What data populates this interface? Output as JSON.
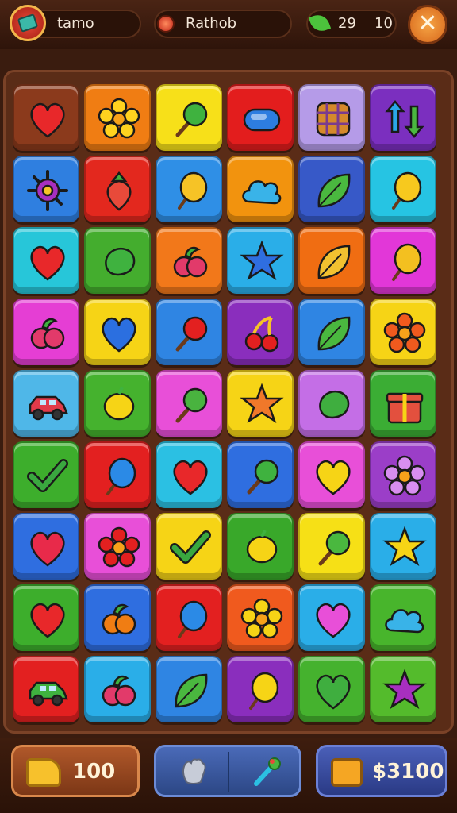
{
  "hud": {
    "player_name": "tamo",
    "resource_label": "Rathob",
    "leaf_count": "29",
    "moves": "10"
  },
  "bottom": {
    "coins": "100",
    "cash": "$3100"
  },
  "icons": {
    "profile": "profile-card-icon",
    "resource": "gem-icon",
    "leaf": "leaf-icon",
    "close": "close-icon",
    "coins": "cheese-coin-icon",
    "tool1": "glove-icon",
    "tool2": "wand-icon",
    "cash": "treasure-box-icon"
  },
  "close_glyph": "✕",
  "board": {
    "rows": 9,
    "cols": 6,
    "tiles": [
      [
        {
          "bg": "#8b3a1c",
          "icon": "heart",
          "color": "#e8282a"
        },
        {
          "bg": "#f07d13",
          "icon": "flower",
          "color": "#ffd21f"
        },
        {
          "bg": "#f7e019",
          "icon": "lollipop",
          "color": "#3fb23f"
        },
        {
          "bg": "#e31d1d",
          "icon": "capsule",
          "color": "#2d7de0"
        },
        {
          "bg": "#b59be8",
          "icon": "waffle",
          "color": "#7a3b8e"
        },
        {
          "bg": "#7b2fbf",
          "icon": "arrows",
          "color": "#2aa8e8"
        }
      ],
      [
        {
          "bg": "#2f7fe0",
          "icon": "virus",
          "color": "#a72fbf"
        },
        {
          "bg": "#e3281e",
          "icon": "strawberry",
          "color": "#e84a3a"
        },
        {
          "bg": "#2f8fe6",
          "icon": "balloon",
          "color": "#f6c326"
        },
        {
          "bg": "#f2930e",
          "icon": "cloud",
          "color": "#39b3e8"
        },
        {
          "bg": "#3759c8",
          "icon": "leaf",
          "color": "#4ab83f"
        },
        {
          "bg": "#26c4e3",
          "icon": "balloon",
          "color": "#f7c91e"
        }
      ],
      [
        {
          "bg": "#27c6d9",
          "icon": "heart",
          "color": "#e8282a"
        },
        {
          "bg": "#44ad2e",
          "icon": "bean",
          "color": "#3fb23f"
        },
        {
          "bg": "#f2781a",
          "icon": "berry",
          "color": "#e23a6a"
        },
        {
          "bg": "#2aaee8",
          "icon": "star",
          "color": "#2f6ee0"
        },
        {
          "bg": "#f06d12",
          "icon": "leaf",
          "color": "#f2c230"
        },
        {
          "bg": "#e237d8",
          "icon": "balloon",
          "color": "#f3c020"
        }
      ],
      [
        {
          "bg": "#e53ed4",
          "icon": "berry",
          "color": "#e23a6a"
        },
        {
          "bg": "#f6d416",
          "icon": "heart",
          "color": "#2b6fe0"
        },
        {
          "bg": "#2f85e3",
          "icon": "lollipop",
          "color": "#e32020"
        },
        {
          "bg": "#8a2ebd",
          "icon": "cherry",
          "color": "#e32020"
        },
        {
          "bg": "#2f85e3",
          "icon": "leaf",
          "color": "#4ab83f"
        },
        {
          "bg": "#f6d416",
          "icon": "flower",
          "color": "#f05a1e"
        }
      ],
      [
        {
          "bg": "#4fb7e8",
          "icon": "car",
          "color": "#e23a4a"
        },
        {
          "bg": "#45b22e",
          "icon": "lemon",
          "color": "#f6d416"
        },
        {
          "bg": "#e84fd8",
          "icon": "lollipop",
          "color": "#49b33f"
        },
        {
          "bg": "#f6d416",
          "icon": "star",
          "color": "#f0782a"
        },
        {
          "bg": "#c46ee6",
          "icon": "bean",
          "color": "#3fae3f"
        },
        {
          "bg": "#3bad34",
          "icon": "gift",
          "color": "#e3503e"
        }
      ],
      [
        {
          "bg": "#3dae2c",
          "icon": "check",
          "color": "#3aa83f"
        },
        {
          "bg": "#e32020",
          "icon": "balloon",
          "color": "#2b8ae6"
        },
        {
          "bg": "#2bc0e3",
          "icon": "heart",
          "color": "#e8282a"
        },
        {
          "bg": "#2f6ee0",
          "icon": "lollipop",
          "color": "#3fb23f"
        },
        {
          "bg": "#e84fd8",
          "icon": "heart",
          "color": "#f6d416"
        },
        {
          "bg": "#9b3ec8",
          "icon": "flower",
          "color": "#d88ef0"
        }
      ],
      [
        {
          "bg": "#2f6ee0",
          "icon": "heart",
          "color": "#e82a4a"
        },
        {
          "bg": "#e84fd8",
          "icon": "flower",
          "color": "#e32020"
        },
        {
          "bg": "#f6d416",
          "icon": "check",
          "color": "#3aa83f"
        },
        {
          "bg": "#39a82a",
          "icon": "lemon",
          "color": "#f6d416"
        },
        {
          "bg": "#f6e016",
          "icon": "lollipop",
          "color": "#4ab83f"
        },
        {
          "bg": "#2aaee8",
          "icon": "star",
          "color": "#f6d416"
        }
      ],
      [
        {
          "bg": "#3dae2c",
          "icon": "heart",
          "color": "#e8282a"
        },
        {
          "bg": "#2f6ee0",
          "icon": "berry",
          "color": "#f07d13"
        },
        {
          "bg": "#e32020",
          "icon": "balloon",
          "color": "#2b8ae6"
        },
        {
          "bg": "#f05a1e",
          "icon": "flower",
          "color": "#f6d416"
        },
        {
          "bg": "#2aaee8",
          "icon": "heart",
          "color": "#e84fd8"
        },
        {
          "bg": "#48b52c",
          "icon": "cloud",
          "color": "#39b3e8"
        }
      ],
      [
        {
          "bg": "#e32020",
          "icon": "car",
          "color": "#3fb23f"
        },
        {
          "bg": "#2aaee8",
          "icon": "berry",
          "color": "#e23a6a"
        },
        {
          "bg": "#2f85e3",
          "icon": "leaf",
          "color": "#4ab83f"
        },
        {
          "bg": "#8a2ebd",
          "icon": "balloon",
          "color": "#f6d416"
        },
        {
          "bg": "#45b22e",
          "icon": "heart",
          "color": "#3fae3f"
        },
        {
          "bg": "#54bb2c",
          "icon": "star",
          "color": "#a72fbf"
        }
      ]
    ]
  }
}
